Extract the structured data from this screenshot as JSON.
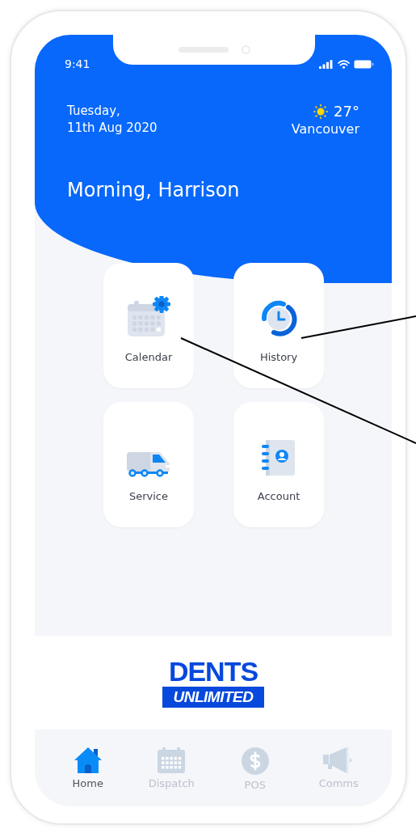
{
  "status_bar": {
    "time": "9:41"
  },
  "header": {
    "date_lines": [
      "Tuesday,",
      "11th Aug 2020"
    ],
    "temperature": "27°",
    "city": "Vancouver",
    "greeting": "Morning, Harrison"
  },
  "tiles": [
    {
      "label": "Calendar",
      "kind": "calendar"
    },
    {
      "label": "History",
      "kind": "history"
    },
    {
      "label": "Service",
      "kind": "service"
    },
    {
      "label": "Account",
      "kind": "account"
    }
  ],
  "logo": {
    "top": "DENTS",
    "bottom": "UNLIMITED"
  },
  "nav": [
    {
      "label": "Home",
      "kind": "home",
      "selected": true
    },
    {
      "label": "Dispatch",
      "kind": "dispatch",
      "selected": false
    },
    {
      "label": "POS",
      "kind": "pos",
      "selected": false
    },
    {
      "label": "Comms",
      "kind": "comms",
      "selected": false
    }
  ]
}
